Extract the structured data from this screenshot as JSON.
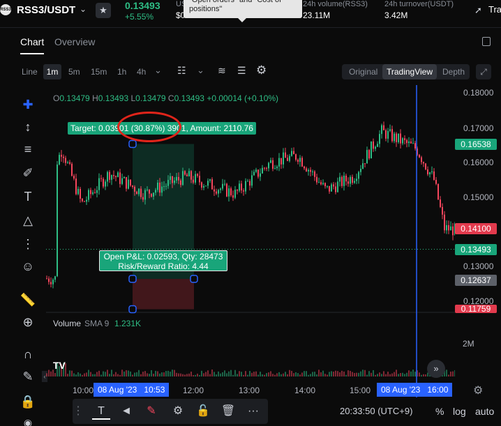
{
  "header": {
    "coin_logo_text": "RSS3",
    "pair": "RSS3/USDT",
    "price": "0.13493",
    "change": "+5.55%",
    "usd_label": "US",
    "usd_value": "$0",
    "tooltip": "\"Open orders\" and \"Cost of positions\"",
    "volume_label": "24h volume(RSS3)",
    "volume_value": "23.11M",
    "turnover_label": "24h turnover(USDT)",
    "turnover_value": "3.42M",
    "tv_text": "Tra",
    "icons": {
      "chevron": "chevron-down-icon",
      "star": "star-icon",
      "tradingview": "tradingview-icon"
    }
  },
  "tabs": {
    "chart": "Chart",
    "overview": "Overview"
  },
  "toolbar": {
    "line": "Line",
    "timeframes": [
      "1m",
      "5m",
      "15m",
      "1h",
      "4h"
    ],
    "active_timeframe": "1m",
    "views": {
      "original": "Original",
      "tradingview": "TradingView",
      "depth": "Depth"
    },
    "active_view": "TradingView"
  },
  "legend": {
    "o_label": "O",
    "o": "0.13479",
    "h_label": "H",
    "h": "0.13493",
    "l_label": "L",
    "l": "0.13479",
    "c_label": "C",
    "c": "0.13493",
    "change": "+0.00014 (+0.10%)"
  },
  "position_tool": {
    "target_text": "Target: 0.03901 (30.87%) 3901, Amount: 2110.76",
    "pnl_line1": "Open P&L: 0.02593, Qty: 28473",
    "pnl_line2": "Risk/Reward Ratio: 4.44"
  },
  "price_axis": {
    "ticks": [
      "0.18000",
      "0.17000",
      "0.16000",
      "0.15000",
      "0.14000",
      "0.13000",
      "0.12000"
    ],
    "badges": [
      {
        "value": "0.16538",
        "color": "#19a57a"
      },
      {
        "value": "0.14100",
        "color": "#e23a4d"
      },
      {
        "value": "0.13493",
        "color": "#19a57a"
      },
      {
        "value": "0.12637",
        "color": "#5d6169"
      },
      {
        "value": "0.11759",
        "color": "#e23a4d"
      }
    ]
  },
  "volume": {
    "label": "Volume",
    "sma": "SMA 9",
    "value": "1.231K",
    "axis_tick": "2M"
  },
  "time_axis": {
    "ticks": [
      "10:00",
      "12:00",
      "13:00",
      "14:00",
      "15:00"
    ],
    "badge_left": "08 Aug '23   10:53",
    "badge_right": "08 Aug '23   16:00"
  },
  "bottom": {
    "clock": "20:33:50 (UTC+9)",
    "percent": "%",
    "log": "log",
    "auto": "auto",
    "more": "···"
  },
  "colors": {
    "up": "#2ebd85",
    "down": "#f6465d",
    "accent": "#2962ff",
    "background": "#0b0b0b"
  }
}
